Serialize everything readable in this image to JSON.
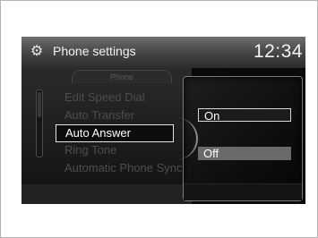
{
  "header": {
    "title": "Phone settings",
    "clock": "12:34",
    "icon": "gear-icon"
  },
  "tab": {
    "label": "Phone"
  },
  "menu": {
    "items": [
      {
        "label": "Edit Speed Dial",
        "selected": false
      },
      {
        "label": "Auto Transfer",
        "selected": false
      },
      {
        "label": "Auto Answer",
        "selected": true
      },
      {
        "label": "Ring Tone",
        "selected": false
      },
      {
        "label": "Automatic Phone Sync",
        "selected": false
      }
    ]
  },
  "popup": {
    "options": [
      {
        "label": "On",
        "focused": true
      },
      {
        "label": "Off",
        "highlighted": true
      }
    ]
  }
}
